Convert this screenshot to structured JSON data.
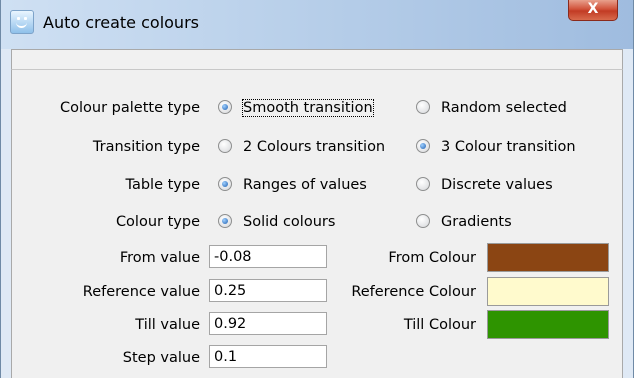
{
  "window": {
    "title": "Auto create colours",
    "close_symbol": "X"
  },
  "rows": [
    {
      "label": "Colour palette type",
      "options": [
        {
          "label": "Smooth transition",
          "selected": true,
          "focused": true
        },
        {
          "label": "Random selected",
          "selected": false
        }
      ]
    },
    {
      "label": "Transition type",
      "options": [
        {
          "label": "2 Colours transition",
          "selected": false
        },
        {
          "label": "3 Colour transition",
          "selected": true
        }
      ]
    },
    {
      "label": "Table type",
      "options": [
        {
          "label": "Ranges of values",
          "selected": true
        },
        {
          "label": "Discrete values",
          "selected": false
        }
      ]
    },
    {
      "label": "Colour type",
      "options": [
        {
          "label": "Solid colours",
          "selected": true
        },
        {
          "label": "Gradients",
          "selected": false
        }
      ]
    }
  ],
  "fields": {
    "from_value": {
      "label": "From value",
      "value": "-0.08"
    },
    "reference_value": {
      "label": "Reference value",
      "value": "0.25"
    },
    "till_value": {
      "label": "Till value",
      "value": "0.92"
    },
    "step_value": {
      "label": "Step value",
      "value": "0.1"
    }
  },
  "colours": {
    "from": {
      "label": "From Colour",
      "color": "#8b4513"
    },
    "reference": {
      "label": "Reference Colour",
      "color": "#fffacd"
    },
    "till": {
      "label": "Till Colour",
      "color": "#2e9400"
    }
  }
}
